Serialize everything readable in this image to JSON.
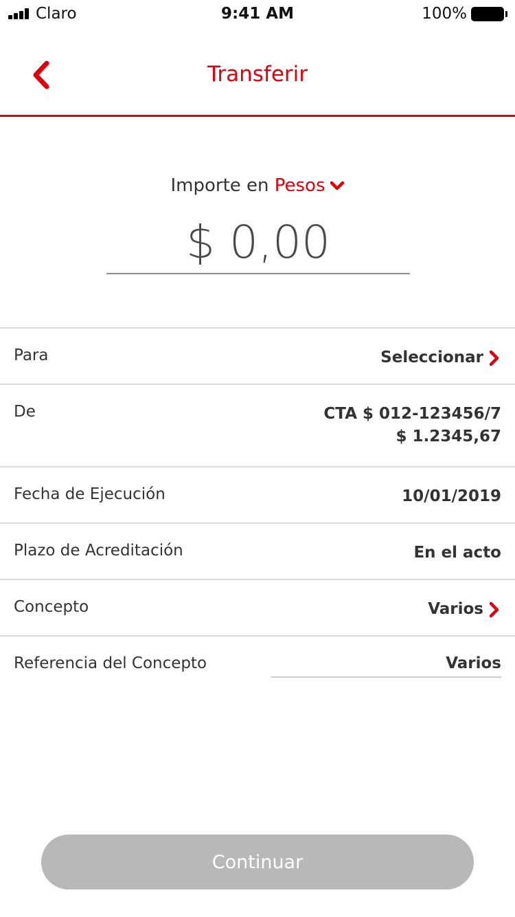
{
  "status_bar": {
    "carrier": "Claro",
    "time": "9:41 AM",
    "battery": "100%"
  },
  "nav": {
    "title": "Transferir",
    "back_icon": "chevron-left-icon"
  },
  "amount": {
    "label": "Importe en",
    "currency": "Pesos",
    "placeholder": "$ 0,00",
    "value": ""
  },
  "rows": {
    "para": {
      "label": "Para",
      "value": "Seleccionar"
    },
    "de": {
      "label": "De",
      "account": "CTA $ 012-123456/7",
      "balance": "$ 1.2345,67"
    },
    "fecha": {
      "label": "Fecha de Ejecución",
      "value": "10/01/2019"
    },
    "plazo": {
      "label": "Plazo de Acreditación",
      "value": "En el acto"
    },
    "concepto": {
      "label": "Concepto",
      "value": "Varios"
    },
    "referencia": {
      "label": "Referencia del Concepto",
      "placeholder": "Varios"
    }
  },
  "button": {
    "continue": "Continuar"
  },
  "colors": {
    "accent": "#e4000b",
    "button_disabled": "#b8b8b8",
    "divider": "#dcdcdc"
  }
}
